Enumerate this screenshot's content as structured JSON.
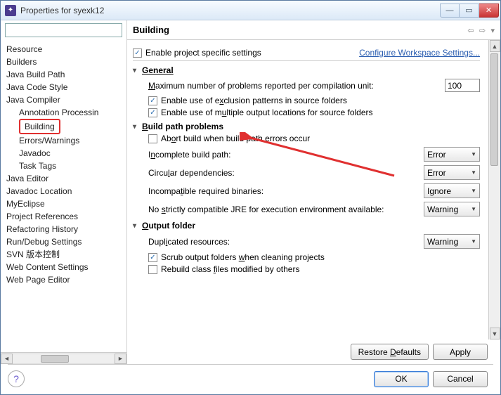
{
  "window": {
    "title": "Properties for syexk12"
  },
  "sidebar": {
    "search_placeholder": "",
    "items": [
      {
        "label": "Resource",
        "lvl": 0
      },
      {
        "label": "Builders",
        "lvl": 0
      },
      {
        "label": "Java Build Path",
        "lvl": 0
      },
      {
        "label": "Java Code Style",
        "lvl": 0
      },
      {
        "label": "Java Compiler",
        "lvl": 0
      },
      {
        "label": "Annotation Processin",
        "lvl": 1
      },
      {
        "label": "Building",
        "lvl": 1,
        "selected": true,
        "highlight": true
      },
      {
        "label": "Errors/Warnings",
        "lvl": 1
      },
      {
        "label": "Javadoc",
        "lvl": 1
      },
      {
        "label": "Task Tags",
        "lvl": 1
      },
      {
        "label": "Java Editor",
        "lvl": 0
      },
      {
        "label": "Javadoc Location",
        "lvl": 0
      },
      {
        "label": "MyEclipse",
        "lvl": 0
      },
      {
        "label": "Project References",
        "lvl": 0
      },
      {
        "label": "Refactoring History",
        "lvl": 0
      },
      {
        "label": "Run/Debug Settings",
        "lvl": 0
      },
      {
        "label": "SVN 版本控制",
        "lvl": 0
      },
      {
        "label": "Web Content Settings",
        "lvl": 0
      },
      {
        "label": "Web Page Editor",
        "lvl": 0
      }
    ]
  },
  "main": {
    "heading": "Building",
    "enable_specific": "Enable project specific settings",
    "enable_specific_checked": true,
    "configure_link": "Configure Workspace Settings...",
    "sections": {
      "general": {
        "title": "General",
        "max_problems_label": "Maximum number of problems reported per compilation unit:",
        "max_problems_value": "100",
        "exclusion": "Enable use of exclusion patterns in source folders",
        "exclusion_checked": true,
        "multiple": "Enable use of multiple output locations for source folders",
        "multiple_checked": true
      },
      "buildpath": {
        "title": "Build path problems",
        "abort": "Abort build when build path errors occur",
        "abort_checked": false,
        "incomplete": {
          "label": "Incomplete build path:",
          "value": "Error"
        },
        "circular": {
          "label": "Circular dependencies:",
          "value": "Error"
        },
        "incompat": {
          "label": "Incompatible required binaries:",
          "value": "Ignore"
        },
        "nojre": {
          "label": "No strictly compatible JRE for execution environment available:",
          "value": "Warning"
        }
      },
      "output": {
        "title": "Output folder",
        "dup": {
          "label": "Duplicated resources:",
          "value": "Warning"
        },
        "scrub": "Scrub output folders when cleaning projects",
        "scrub_checked": true,
        "rebuild": "Rebuild class files modified by others",
        "rebuild_checked": false
      }
    },
    "buttons": {
      "restore": "Restore Defaults",
      "apply": "Apply",
      "ok": "OK",
      "cancel": "Cancel"
    }
  }
}
